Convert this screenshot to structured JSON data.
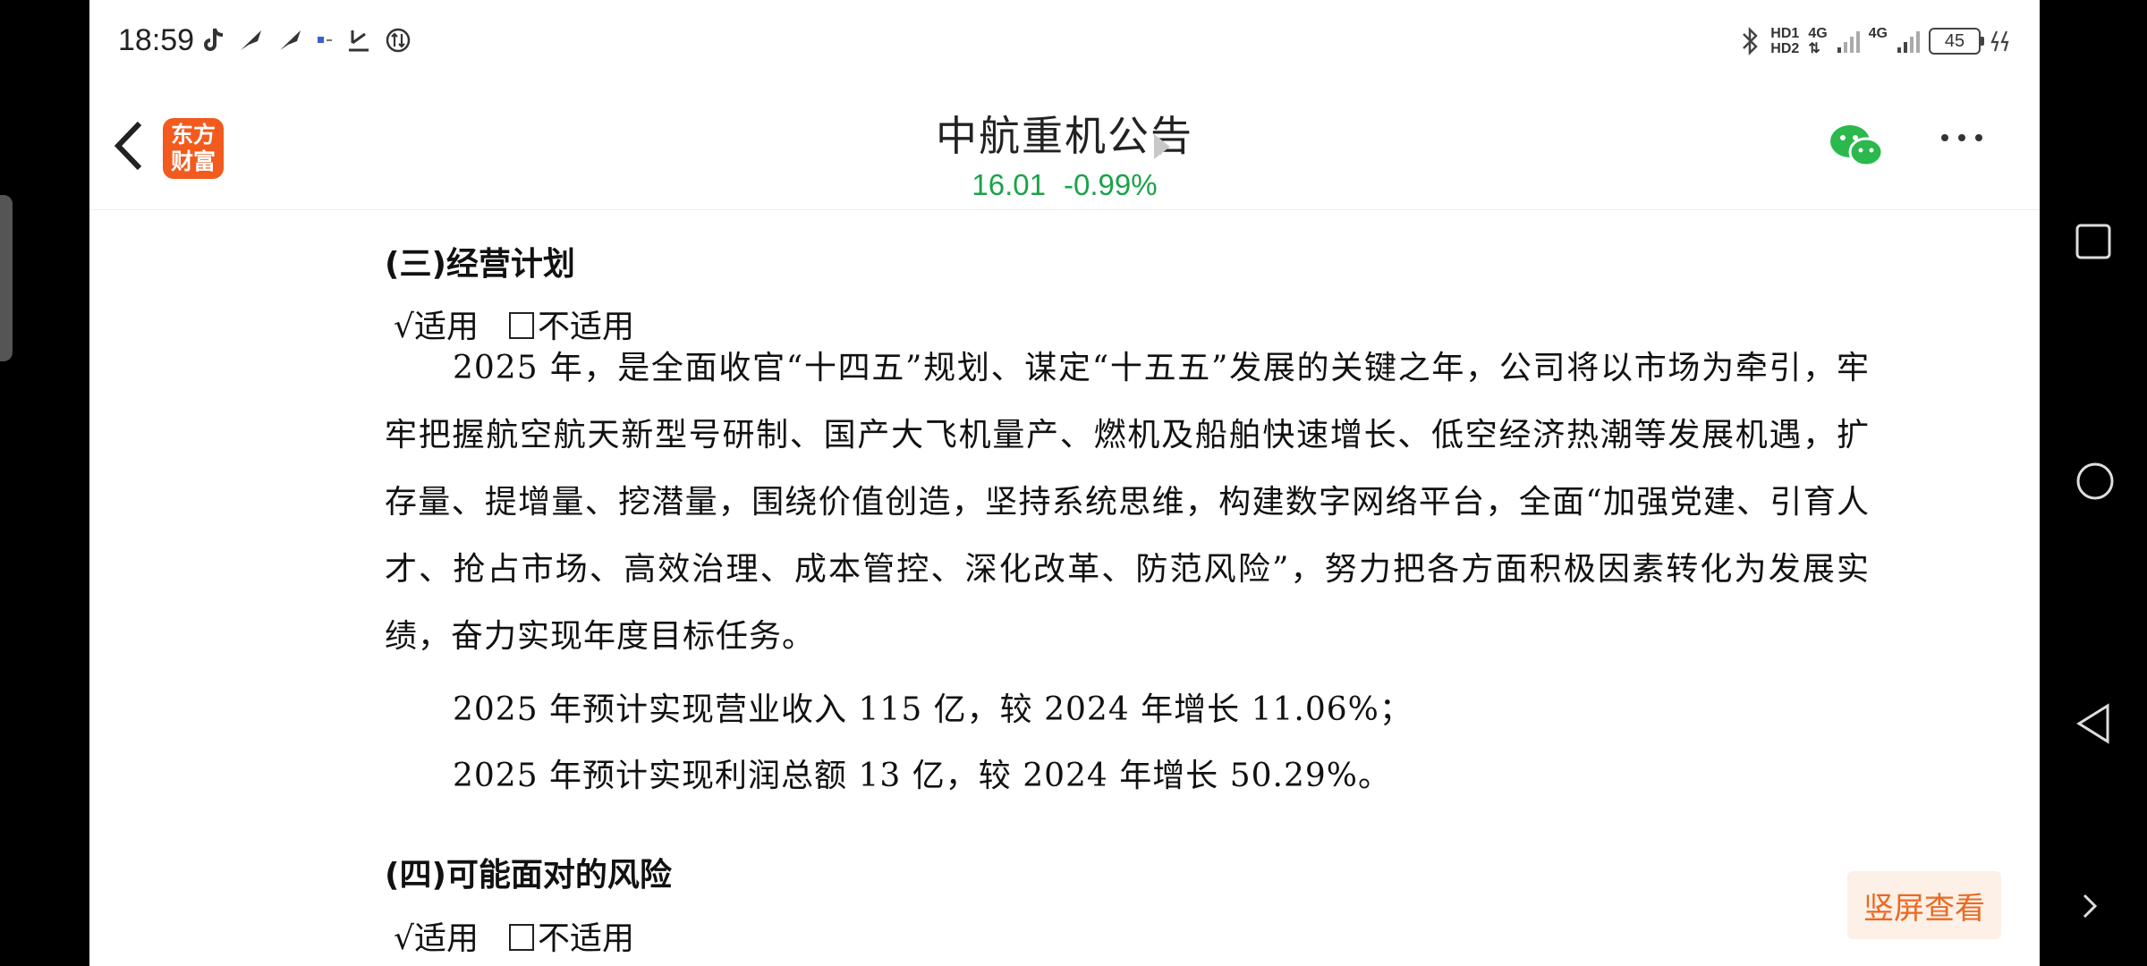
{
  "status": {
    "time": "18:59",
    "hd1": "HD1",
    "hd2": "HD2",
    "net1": "4G",
    "net2": "4G",
    "battery": "45"
  },
  "header": {
    "logo_line1": "东方",
    "logo_line2": "财富",
    "title": "中航重机公告",
    "price": "16.01",
    "change": "-0.99%",
    "quote_color": "#1aa34a"
  },
  "doc": {
    "section3_heading": "(三)经营计划",
    "check_applicable": "√适用",
    "check_not_applicable": "不适用",
    "section3_paragraph": "2025 年，是全面收官“十四五”规划、谋定“十五五”发展的关键之年，公司将以市场为牵引，牢牢把握航空航天新型号研制、国产大飞机量产、燃机及船舶快速增长、低空经济热潮等发展机遇，扩存量、提增量、挖潜量，围绕价值创造，坚持系统思维，构建数字网络平台，全面“加强党建、引育人才、抢占市场、高效治理、成本管控、深化改革、防范风险”，努力把各方面积极因素转化为发展实绩，奋力实现年度目标任务。",
    "revenue_line": "2025 年预计实现营业收入 115 亿，较 2024 年增长 11.06%；",
    "profit_line": "2025 年预计实现利润总额 13 亿，较 2024 年增长 50.29%。",
    "section4_heading": "(四)可能面对的风险",
    "check_applicable_2": "√适用",
    "check_not_applicable_2": "不适用"
  },
  "actions": {
    "portrait_view": "竖屏查看"
  },
  "colors": {
    "accent": "#f35a1d",
    "portrait_text": "#ea6a24"
  }
}
